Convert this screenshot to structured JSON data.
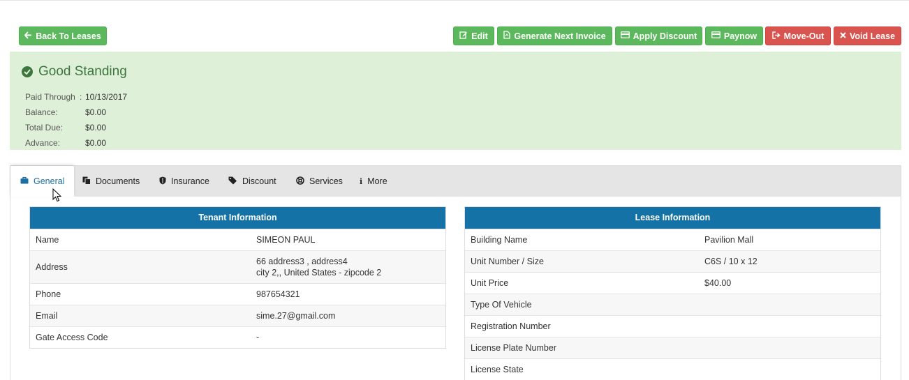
{
  "toolbar": {
    "back_label": "Back To Leases",
    "edit_label": "Edit",
    "generate_invoice_label": "Generate Next Invoice",
    "apply_discount_label": "Apply Discount",
    "paynow_label": "Paynow",
    "move_out_label": "Move-Out",
    "void_lease_label": "Void Lease"
  },
  "standing": {
    "title": "Good Standing",
    "rows": [
      {
        "label": "Paid Through",
        "sep": ":",
        "value": "10/13/2017"
      },
      {
        "label": "Balance:",
        "value": "$0.00"
      },
      {
        "label": "Total Due:",
        "value": "$0.00"
      },
      {
        "label": "Advance:",
        "value": "$0.00"
      }
    ]
  },
  "tabs": [
    {
      "label": "General",
      "icon": "briefcase-icon",
      "active": true
    },
    {
      "label": "Documents",
      "icon": "copy-icon"
    },
    {
      "label": "Insurance",
      "icon": "shield-icon"
    },
    {
      "label": "Discount",
      "icon": "tags-icon"
    },
    {
      "label": "Services",
      "icon": "life-ring-icon"
    },
    {
      "label": "More",
      "icon": "info-icon"
    }
  ],
  "tenant": {
    "header": "Tenant Information",
    "rows": [
      {
        "key": "Name",
        "value": "SIMEON PAUL"
      },
      {
        "key": "Address",
        "value_line1": "66 address3 , address4",
        "value_line2": "city 2,, United States - zipcode 2"
      },
      {
        "key": "Phone",
        "value": "987654321"
      },
      {
        "key": "Email",
        "value": "sime.27@gmail.com"
      },
      {
        "key": "Gate Access Code",
        "value": "-"
      }
    ]
  },
  "lease": {
    "header": "Lease Information",
    "rows": [
      {
        "key": "Building Name",
        "value": "Pavilion Mall"
      },
      {
        "key": "Unit Number / Size",
        "value": "C6S / 10 x 12"
      },
      {
        "key": "Unit Price",
        "value": "$40.00"
      },
      {
        "key": "Type Of Vehicle",
        "value": ""
      },
      {
        "key": "Registration Number",
        "value": ""
      },
      {
        "key": "License Plate Number",
        "value": ""
      },
      {
        "key": "License State",
        "value": ""
      }
    ]
  },
  "colors": {
    "green": "#5cb85c",
    "red": "#d9534f",
    "standing_bg": "#dff0d8",
    "standing_text": "#3c763d",
    "table_header": "#1472a6",
    "active_tab": "#1a6fa3"
  }
}
